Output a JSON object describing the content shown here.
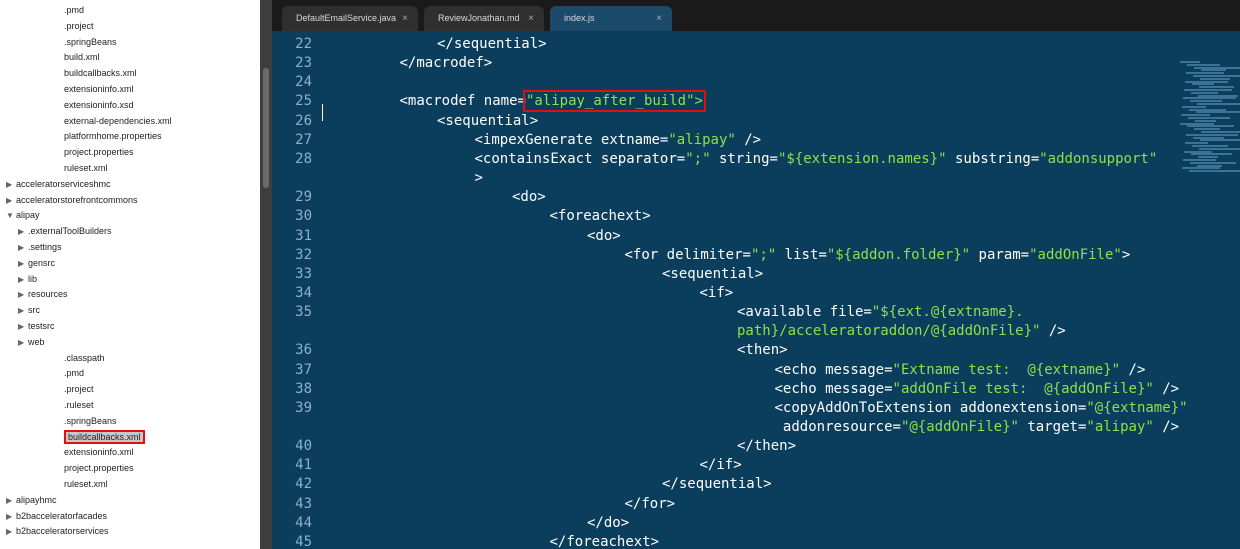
{
  "sidebar": {
    "items": [
      {
        "label": ".pmd",
        "indent": 2
      },
      {
        "label": ".project",
        "indent": 2
      },
      {
        "label": ".springBeans",
        "indent": 2
      },
      {
        "label": "build.xml",
        "indent": 2
      },
      {
        "label": "buildcallbacks.xml",
        "indent": 2
      },
      {
        "label": "extensioninfo.xml",
        "indent": 2
      },
      {
        "label": "extensioninfo.xsd",
        "indent": 2
      },
      {
        "label": "external-dependencies.xml",
        "indent": 2
      },
      {
        "label": "platformhome.properties",
        "indent": 2
      },
      {
        "label": "project.properties",
        "indent": 2
      },
      {
        "label": "ruleset.xml",
        "indent": 2
      },
      {
        "label": "acceleratorserviceshmc",
        "indent": 0,
        "toggle": "▶"
      },
      {
        "label": "acceleratorstorefrontcommons",
        "indent": 0,
        "toggle": "▶"
      },
      {
        "label": "alipay",
        "indent": 0,
        "toggle": "▼"
      },
      {
        "label": ".externalToolBuilders",
        "indent": 1,
        "toggle": "▶"
      },
      {
        "label": ".settings",
        "indent": 1,
        "toggle": "▶"
      },
      {
        "label": "gensrc",
        "indent": 1,
        "toggle": "▶"
      },
      {
        "label": "lib",
        "indent": 1,
        "toggle": "▶"
      },
      {
        "label": "resources",
        "indent": 1,
        "toggle": "▶"
      },
      {
        "label": "src",
        "indent": 1,
        "toggle": "▶"
      },
      {
        "label": "testsrc",
        "indent": 1,
        "toggle": "▶"
      },
      {
        "label": "web",
        "indent": 1,
        "toggle": "▶"
      },
      {
        "label": ".classpath",
        "indent": 2
      },
      {
        "label": ".pmd",
        "indent": 2
      },
      {
        "label": ".project",
        "indent": 2
      },
      {
        "label": ".ruleset",
        "indent": 2
      },
      {
        "label": ".springBeans",
        "indent": 2
      },
      {
        "label": "buildcallbacks.xml",
        "indent": 2,
        "selected": true
      },
      {
        "label": "extensioninfo.xml",
        "indent": 2
      },
      {
        "label": "project.properties",
        "indent": 2
      },
      {
        "label": "ruleset.xml",
        "indent": 2
      },
      {
        "label": "alipayhmc",
        "indent": 0,
        "toggle": "▶"
      },
      {
        "label": "b2bacceleratorfacades",
        "indent": 0,
        "toggle": "▶"
      },
      {
        "label": "b2bacceleratorservices",
        "indent": 0,
        "toggle": "▶"
      }
    ]
  },
  "tabs": [
    {
      "label": "DefaultEmailService.java",
      "close": "×"
    },
    {
      "label": "ReviewJonathan.md",
      "close": "×"
    },
    {
      "label": "index.js",
      "close": "×"
    }
  ],
  "code": {
    "lines": [
      {
        "num": "22",
        "indent": 2,
        "parts": [
          [
            "t",
            "</sequential>"
          ]
        ]
      },
      {
        "num": "23",
        "indent": 1,
        "parts": [
          [
            "t",
            "</macrodef>"
          ]
        ]
      },
      {
        "num": "24",
        "indent": 0,
        "parts": []
      },
      {
        "num": "25",
        "indent": 1,
        "parts": [
          [
            "t",
            "<macrodef name="
          ],
          [
            "h",
            "\"alipay_after_build\">"
          ]
        ]
      },
      {
        "num": "26",
        "indent": 2,
        "parts": [
          [
            "t",
            "<sequential>"
          ]
        ]
      },
      {
        "num": "27",
        "indent": 3,
        "parts": [
          [
            "t",
            "<impexGenerate extname="
          ],
          [
            "s",
            "\"alipay\""
          ],
          [
            "t",
            " />"
          ]
        ]
      },
      {
        "num": "28",
        "indent": 3,
        "parts": [
          [
            "t",
            "<containsExact separator="
          ],
          [
            "s",
            "\";\""
          ],
          [
            "t",
            " string="
          ],
          [
            "s",
            "\"${extension.names}\""
          ],
          [
            "t",
            " substring="
          ],
          [
            "s",
            "\"addonsupport\""
          ]
        ]
      },
      {
        "num": "",
        "indent": 3,
        "parts": [
          [
            "t",
            ">"
          ]
        ]
      },
      {
        "num": "29",
        "indent": 4,
        "parts": [
          [
            "t",
            "<do>"
          ]
        ]
      },
      {
        "num": "30",
        "indent": 5,
        "parts": [
          [
            "t",
            "<foreachext>"
          ]
        ]
      },
      {
        "num": "31",
        "indent": 6,
        "parts": [
          [
            "t",
            "<do>"
          ]
        ]
      },
      {
        "num": "32",
        "indent": 7,
        "parts": [
          [
            "t",
            "<for delimiter="
          ],
          [
            "s",
            "\";\""
          ],
          [
            "t",
            " list="
          ],
          [
            "s",
            "\"${addon.folder}\""
          ],
          [
            "t",
            " param="
          ],
          [
            "s",
            "\"addOnFile\""
          ],
          [
            "t",
            ">"
          ]
        ]
      },
      {
        "num": "33",
        "indent": 8,
        "parts": [
          [
            "t",
            "<sequential>"
          ]
        ]
      },
      {
        "num": "34",
        "indent": 9,
        "parts": [
          [
            "t",
            "<if>"
          ]
        ]
      },
      {
        "num": "35",
        "indent": 10,
        "parts": [
          [
            "t",
            "<available file="
          ],
          [
            "s",
            "\"${ext.@{extname}."
          ]
        ]
      },
      {
        "num": "",
        "indent": 10,
        "parts": [
          [
            "s",
            "path}/acceleratoraddon/@{addOnFile}\""
          ],
          [
            "t",
            " />"
          ]
        ]
      },
      {
        "num": "36",
        "indent": 10,
        "parts": [
          [
            "t",
            "<then>"
          ]
        ]
      },
      {
        "num": "37",
        "indent": 11,
        "parts": [
          [
            "t",
            "<echo message="
          ],
          [
            "s",
            "\"Extname test:  @{extname}\""
          ],
          [
            "t",
            " />"
          ]
        ]
      },
      {
        "num": "38",
        "indent": 11,
        "parts": [
          [
            "t",
            "<echo message="
          ],
          [
            "s",
            "\"addOnFile test:  @{addOnFile}\""
          ],
          [
            "t",
            " />"
          ]
        ]
      },
      {
        "num": "39",
        "indent": 11,
        "parts": [
          [
            "t",
            "<copyAddOnToExtension addonextension="
          ],
          [
            "s",
            "\"@{extname}\""
          ]
        ]
      },
      {
        "num": "",
        "indent": 11,
        "parts": [
          [
            "t",
            " addonresource="
          ],
          [
            "s",
            "\"@{addOnFile}\""
          ],
          [
            "t",
            " target="
          ],
          [
            "s",
            "\"alipay\""
          ],
          [
            "t",
            " />"
          ]
        ]
      },
      {
        "num": "40",
        "indent": 10,
        "parts": [
          [
            "t",
            "</then>"
          ]
        ]
      },
      {
        "num": "41",
        "indent": 9,
        "parts": [
          [
            "t",
            "</if>"
          ]
        ]
      },
      {
        "num": "42",
        "indent": 8,
        "parts": [
          [
            "t",
            "</sequential>"
          ]
        ]
      },
      {
        "num": "43",
        "indent": 7,
        "parts": [
          [
            "t",
            "</for>"
          ]
        ]
      },
      {
        "num": "44",
        "indent": 6,
        "parts": [
          [
            "t",
            "</do>"
          ]
        ]
      },
      {
        "num": "45",
        "indent": 5,
        "parts": [
          [
            "t",
            "</foreachext>"
          ]
        ]
      }
    ]
  },
  "colors": {
    "editor_bg": "#0b3d5c",
    "string": "#8fe04a",
    "highlight_box": "#e01010"
  }
}
